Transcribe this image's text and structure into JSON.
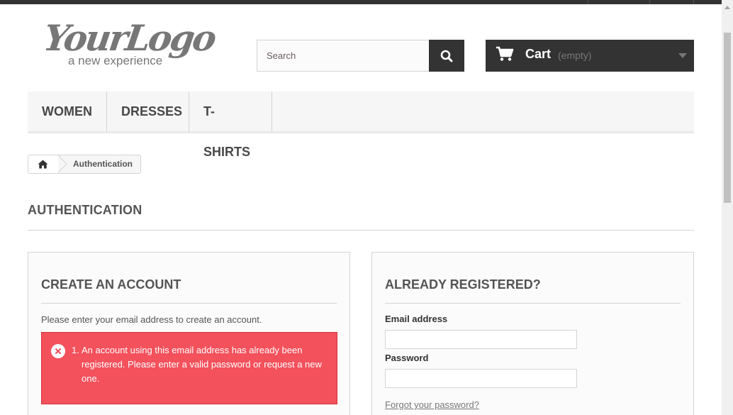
{
  "header": {
    "logo": {
      "main": "YourLogo",
      "tagline": "a new experience"
    },
    "search": {
      "placeholder": "Search",
      "value": "",
      "button_icon": "search-icon"
    },
    "cart": {
      "label": "Cart",
      "status": "(empty)",
      "icon": "cart-icon"
    }
  },
  "menu": {
    "items": [
      {
        "label": "WOMEN"
      },
      {
        "label": "DRESSES"
      },
      {
        "label": "T-SHIRTS"
      }
    ]
  },
  "breadcrumb": {
    "home_icon": "home-icon",
    "current": "Authentication"
  },
  "page": {
    "title": "AUTHENTICATION"
  },
  "create_account": {
    "title": "CREATE AN ACCOUNT",
    "instructions": "Please enter your email address to create an account.",
    "error": {
      "number": "1.",
      "message": "An account using this email address has already been registered. Please enter a valid password or request a new one.",
      "icon": "error-close-icon"
    }
  },
  "login": {
    "title": "ALREADY REGISTERED?",
    "email_label": "Email address",
    "email_value": "",
    "password_label": "Password",
    "password_value": "",
    "forgot_link": "Forgot your password?"
  },
  "colors": {
    "dark": "#333333",
    "error_bg": "#f3515c",
    "panel_bg": "#fbfbfb",
    "menu_bg": "#f6f6f6",
    "border": "#d6d4d4"
  }
}
